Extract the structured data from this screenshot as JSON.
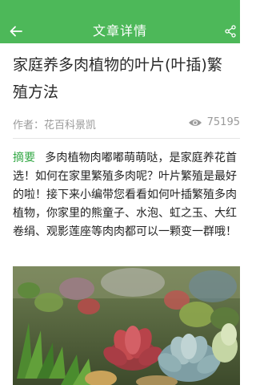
{
  "appbar": {
    "title": "文章详情",
    "back_icon": "back-arrow-icon",
    "share_icon": "share-icon"
  },
  "article": {
    "title": "家庭养多肉植物的叶片(叶插)繁殖方法",
    "author": "作者：花百科景凯",
    "views": "75195",
    "summary_label": "摘要",
    "summary": "多肉植物肉嘟嘟萌萌哒，是家庭养花首选！如何在家里繁殖多肉呢？叶片繁殖是最好的啦！接下来小编带您看看如何叶插繁殖多肉植物，你家里的熊童子、水泡、虹之玉、大红卷绢、观影莲座等肉肉都可以一颗变一群哦！"
  },
  "colors": {
    "brand": "#4db859",
    "summary_label": "#33a845"
  }
}
